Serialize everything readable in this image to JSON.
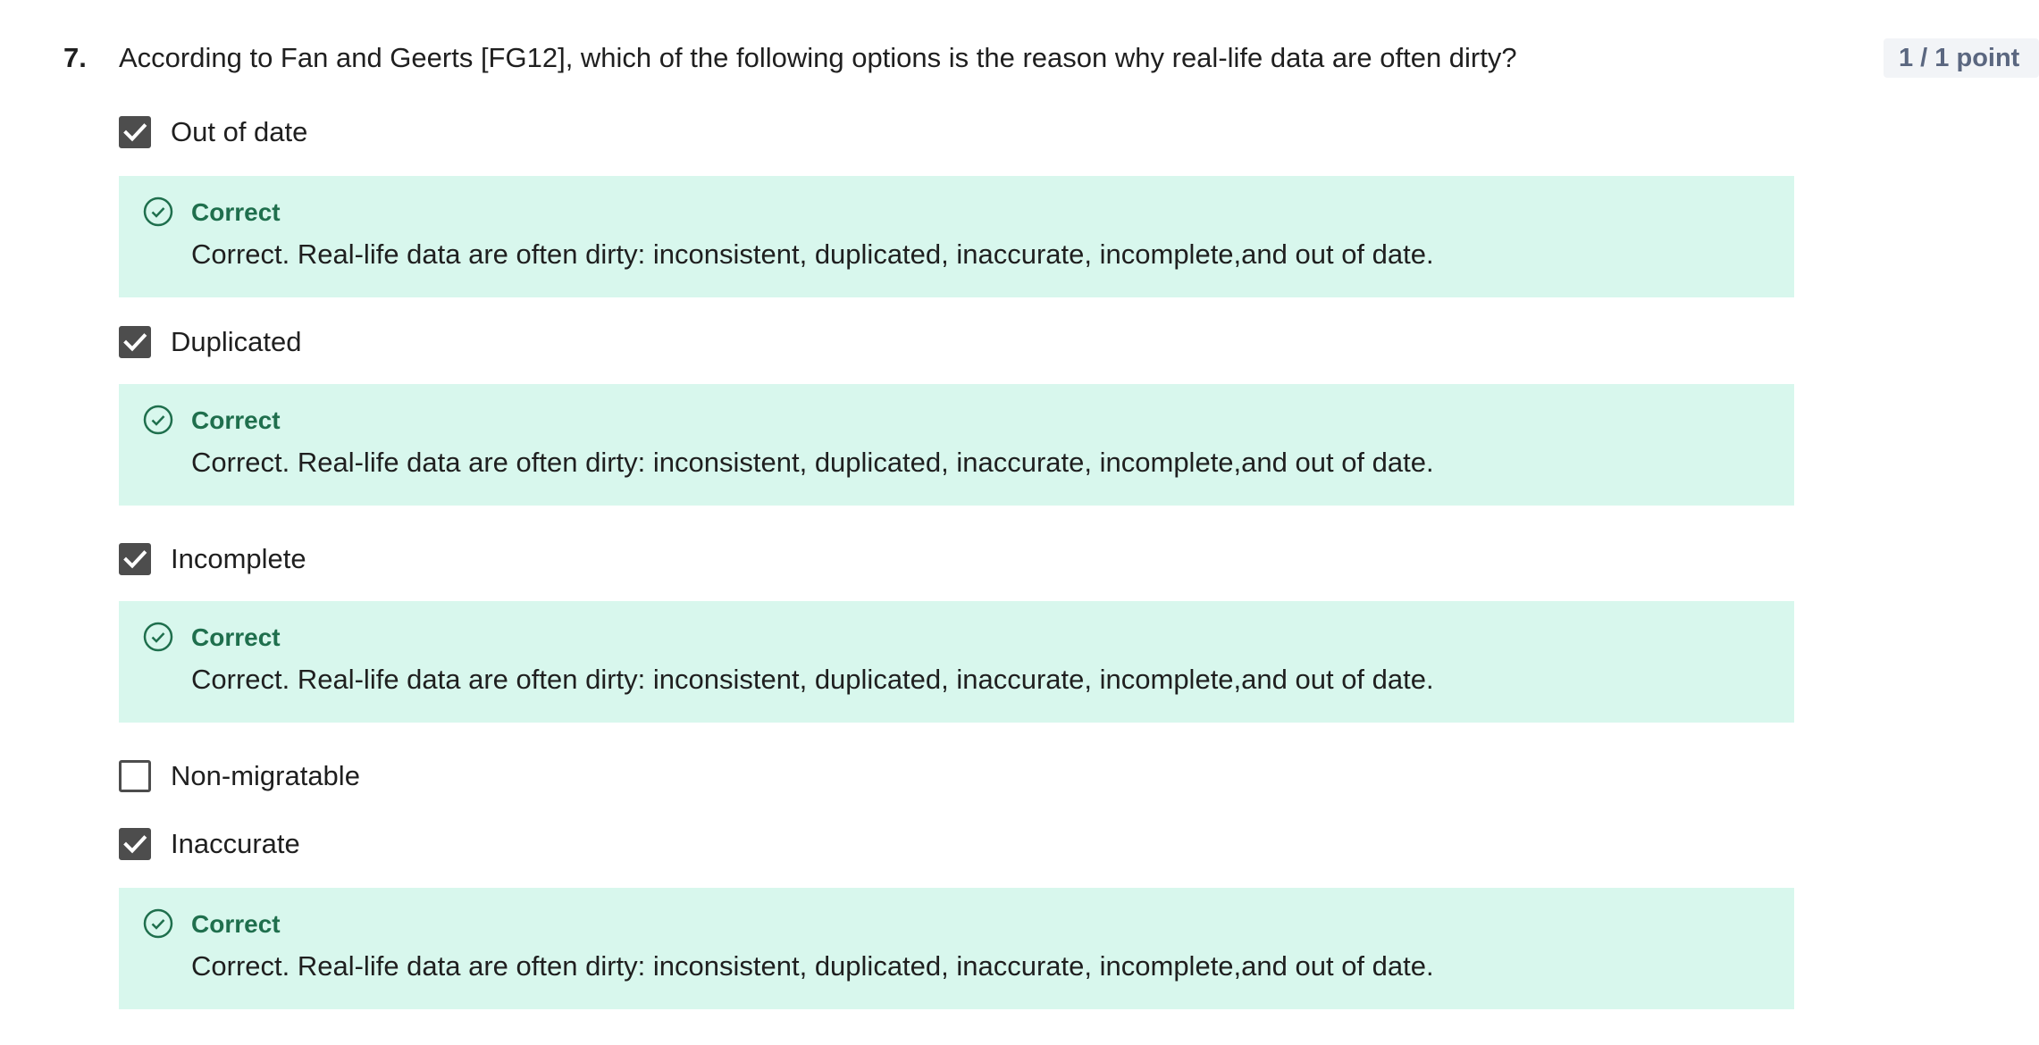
{
  "question": {
    "number": "7.",
    "text": "According to Fan and Geerts [FG12], which of the following options is the reason why real-life data are often dirty?",
    "points": "1 / 1 point"
  },
  "options": [
    {
      "label": "Out of date",
      "checked": true,
      "feedback": {
        "title": "Correct",
        "text": "Correct. Real-life data are often dirty: inconsistent, duplicated, inaccurate, incomplete,and out of date."
      }
    },
    {
      "label": "Duplicated",
      "checked": true,
      "feedback": {
        "title": "Correct",
        "text": "Correct. Real-life data are often dirty: inconsistent, duplicated, inaccurate, incomplete,and out of date."
      }
    },
    {
      "label": "Incomplete",
      "checked": true,
      "feedback": {
        "title": "Correct",
        "text": "Correct. Real-life data are often dirty: inconsistent, duplicated, inaccurate, incomplete,and out of date."
      }
    },
    {
      "label": "Non-migratable",
      "checked": false
    },
    {
      "label": "Inaccurate",
      "checked": true,
      "feedback": {
        "title": "Correct",
        "text": "Correct. Real-life data are often dirty: inconsistent, duplicated, inaccurate, incomplete,and out of date."
      }
    }
  ],
  "icons": {
    "checkbox_checked": "checkmark-icon",
    "feedback": "check-circle-icon"
  },
  "colors": {
    "feedback_bg": "#d8f7ed",
    "feedback_title": "#1f6f4d",
    "checkbox": "#4d4d4d",
    "badge_bg": "#f2f4f7",
    "badge_text": "#5b6780"
  }
}
